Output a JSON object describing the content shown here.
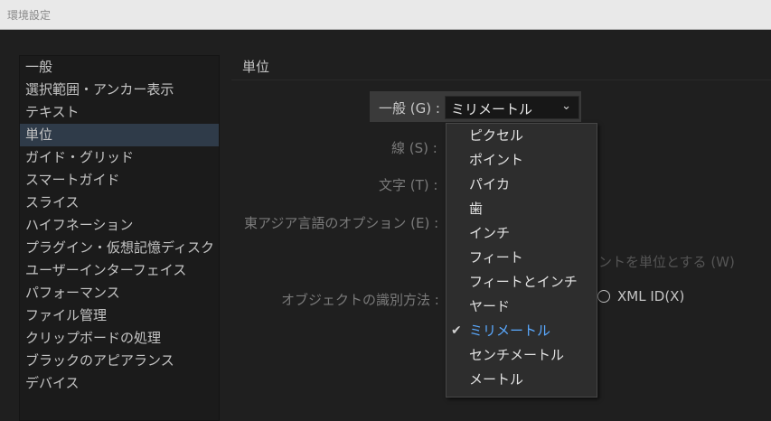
{
  "window": {
    "title": "環境設定"
  },
  "sidebar": {
    "items": [
      {
        "label": "一般"
      },
      {
        "label": "選択範囲・アンカー表示"
      },
      {
        "label": "テキスト"
      },
      {
        "label": "単位"
      },
      {
        "label": "ガイド・グリッド"
      },
      {
        "label": "スマートガイド"
      },
      {
        "label": "スライス"
      },
      {
        "label": "ハイフネーション"
      },
      {
        "label": "プラグイン・仮想記憶ディスク"
      },
      {
        "label": "ユーザーインターフェイス"
      },
      {
        "label": "パフォーマンス"
      },
      {
        "label": "ファイル管理"
      },
      {
        "label": "クリップボードの処理"
      },
      {
        "label": "ブラックのアピアランス"
      },
      {
        "label": "デバイス"
      }
    ],
    "selected": "単位"
  },
  "main": {
    "section_title": "単位",
    "general_label": "一般 (G) :",
    "general_value": "ミリメートル",
    "stroke_label": "線 (S) :",
    "type_label": "文字 (T) :",
    "east_asian_label": "東アジア言語のオプション (E) :",
    "em_unit_partial": "ントを単位とする (W)",
    "object_id_label": "オブジェクトの識別方法 :",
    "xml_id_label": "XML ID(X)"
  },
  "dropdown": {
    "options": [
      {
        "label": "ピクセル"
      },
      {
        "label": "ポイント"
      },
      {
        "label": "パイカ"
      },
      {
        "label": "歯"
      },
      {
        "label": "インチ"
      },
      {
        "label": "フィート"
      },
      {
        "label": "フィートとインチ"
      },
      {
        "label": "ヤード"
      },
      {
        "label": "ミリメートル"
      },
      {
        "label": "センチメートル"
      },
      {
        "label": "メートル"
      }
    ],
    "selected": "ミリメートル",
    "selected_color": "#5aa9ff",
    "check_icon": "checkmark-icon"
  },
  "colors": {
    "selection": "#2f3b49",
    "accent": "#5aa9ff"
  }
}
